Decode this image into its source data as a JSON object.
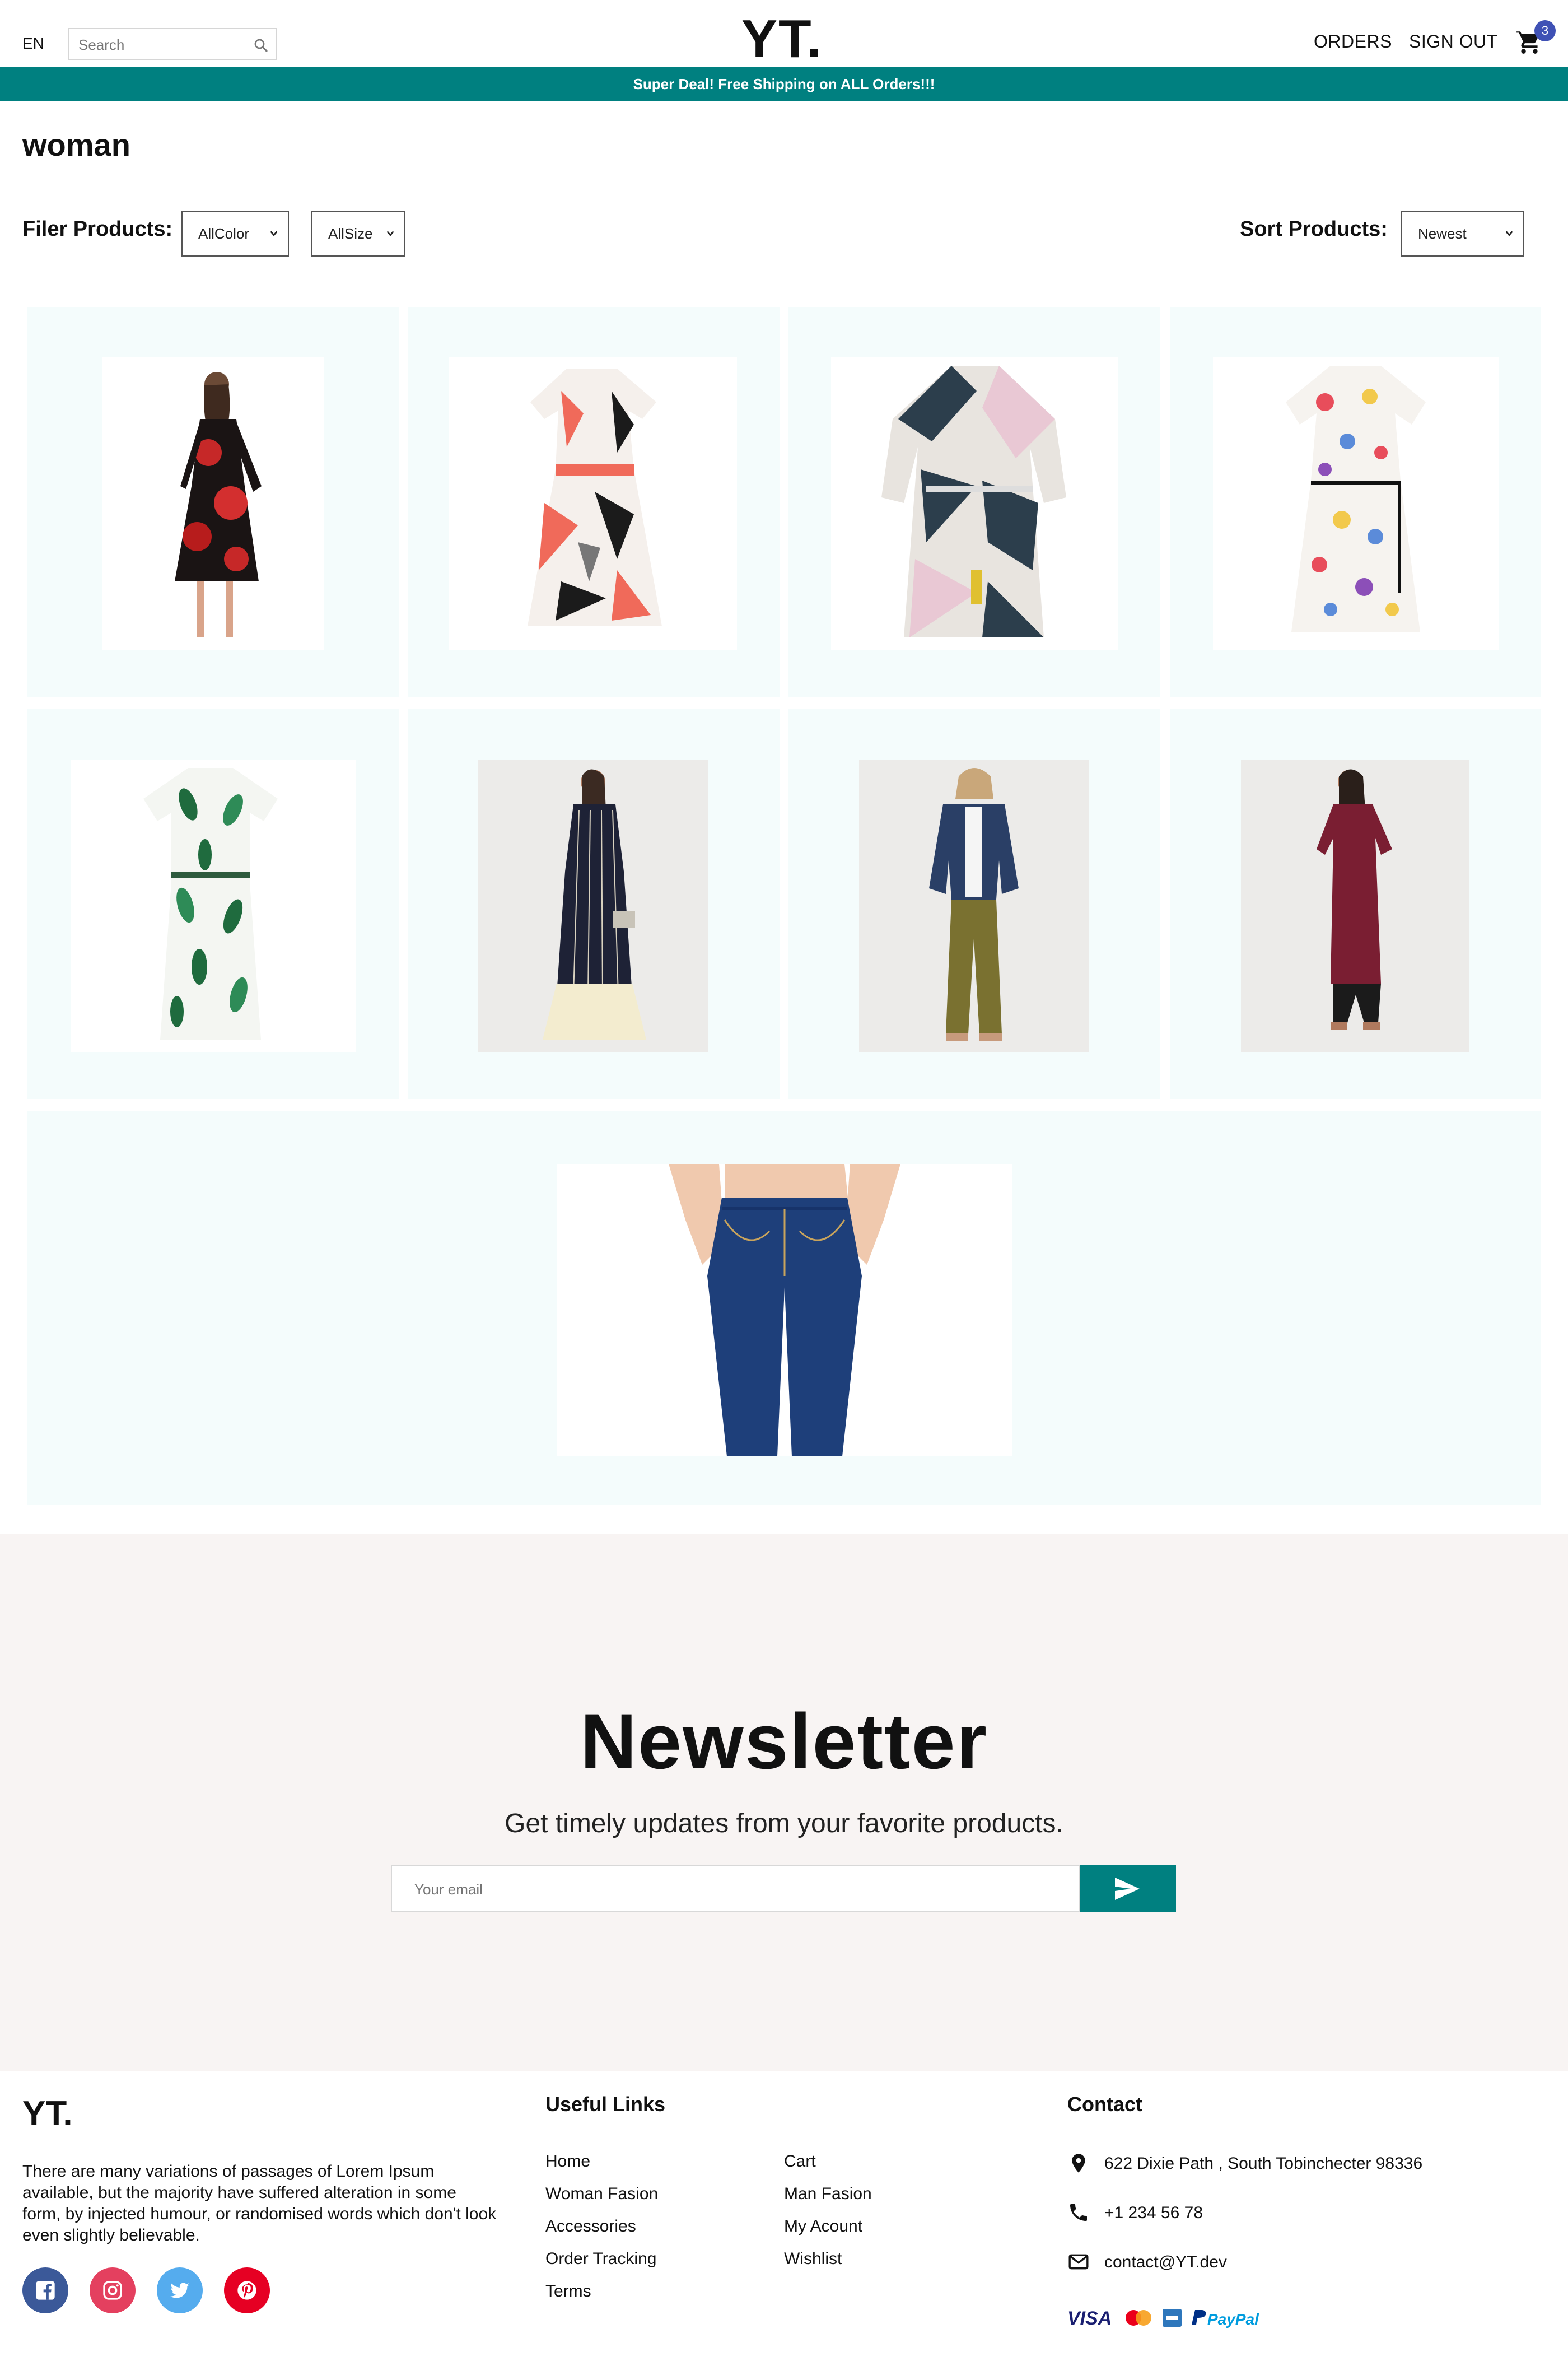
{
  "header": {
    "lang": "EN",
    "search_placeholder": "Search",
    "logo": "YT.",
    "orders": "ORDERS",
    "signout": "SIGN OUT",
    "cart_count": "3"
  },
  "announcement": "Super Deal! Free Shipping on ALL Orders!!!",
  "page": {
    "title": "woman",
    "filter_label": "Filer Products:",
    "color_select": "AllColor",
    "size_select": "AllSize",
    "sort_label": "Sort Products:",
    "sort_select": "Newest"
  },
  "products": [
    {
      "name": "red-floral-dress"
    },
    {
      "name": "coral-abstract-dress"
    },
    {
      "name": "geometric-shift-dress"
    },
    {
      "name": "colorful-print-dress"
    },
    {
      "name": "green-leaf-dress"
    },
    {
      "name": "navy-striped-kurta"
    },
    {
      "name": "denim-jacket-outfit"
    },
    {
      "name": "maroon-kurta"
    },
    {
      "name": "blue-jeans"
    }
  ],
  "newsletter": {
    "title": "Newsletter",
    "description": "Get timely updates from your favorite products.",
    "placeholder": "Your email"
  },
  "footer": {
    "logo": "YT.",
    "description": "There are many variations of passages of Lorem Ipsum available, but the majority have suffered alteration in some form, by injected humour, or randomised words which don't look even slightly believable.",
    "useful_links_title": "Useful Links",
    "links_col1": [
      "Home",
      "Woman Fasion",
      "Accessories",
      "Order Tracking",
      "Terms"
    ],
    "links_col2": [
      "Cart",
      "Man Fasion",
      "My Acount",
      "Wishlist"
    ],
    "contact_title": "Contact",
    "address": "622 Dixie Path , South Tobinchecter 98336",
    "phone": "+1 234 56 78",
    "email": "contact@YT.dev",
    "payments": [
      "VISA",
      "Mastercard",
      "American Express",
      "PayPal"
    ],
    "colors": {
      "facebook": "#3b5999",
      "instagram": "#e4405f",
      "twitter": "#55acee",
      "pinterest": "#e60023"
    }
  }
}
